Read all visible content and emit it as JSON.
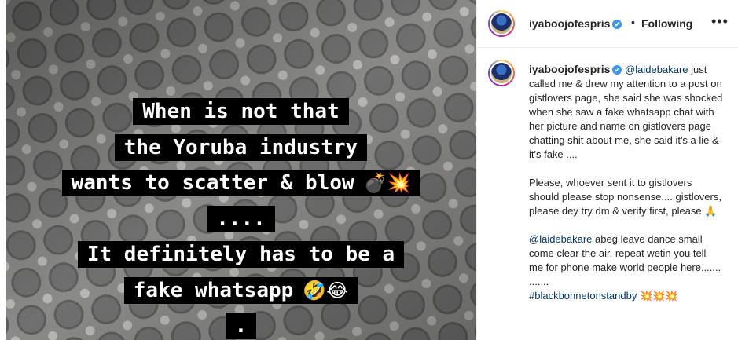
{
  "post": {
    "caption_lines": [
      {
        "text": "When is not that",
        "emoji": ""
      },
      {
        "text": "the Yoruba industry",
        "emoji": ""
      },
      {
        "text": "wants to scatter & blow",
        "emoji": "💣💥"
      },
      {
        "text": "....",
        "emoji": ""
      },
      {
        "text": "It definitely has to be a",
        "emoji": ""
      },
      {
        "text": "fake whatsapp",
        "emoji": "🤣😂"
      },
      {
        "text": ".",
        "emoji": ""
      }
    ]
  },
  "header": {
    "username": "iyaboojofespris",
    "verified_icon": "✔",
    "separator": "•",
    "follow_status": "Following",
    "more_icon": "•••"
  },
  "comment": {
    "username": "iyaboojofespris",
    "verified_icon": "✔",
    "mention1": "@laidebakare",
    "para1_rest": " just called me & drew my attention to a post on gistlovers page, she said she was shocked when she saw a fake whatsapp chat with her picture and name on gistlovers page chatting shit about me, she said it's a lie & it's fake ....",
    "para2": "Please, whoever sent it to gistlovers should please stop nonsense.... gistlovers, please dey try dm & verify first, please 🙏",
    "mention2": "@laidebakare",
    "para3_rest": " abeg leave dance small come clear the air, repeat wetin you tell me for phone make world people here.......",
    "para4": ".......",
    "hashtag": "#blackbonnetonstandby",
    "hashtag_emoji": " 💥💥💥"
  }
}
